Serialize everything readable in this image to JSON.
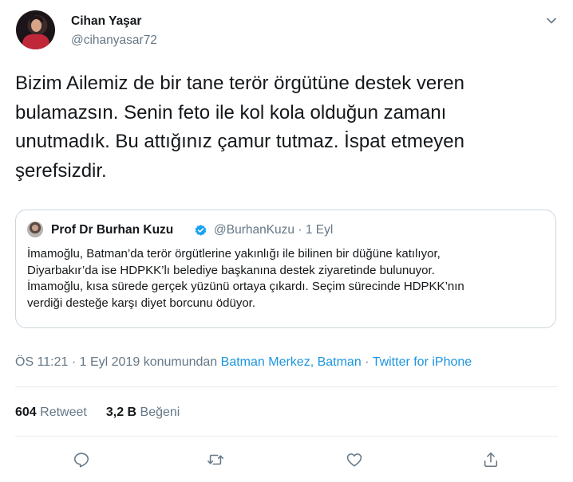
{
  "author": {
    "name": "Cihan Yaşar",
    "handle": "@cihanyasar72"
  },
  "tweet_text": "Bizim Ailemiz de bir tane terör örgütüne destek veren\nbulamazsın. Senin feto ile kol kola olduğun zamanı\nunutmadık. Bu attığınız çamur tutmaz. İspat etmeyen\nşerefsizdir.",
  "quoted": {
    "name": "Prof Dr Burhan Kuzu",
    "handle_date": "@BurhanKuzu · 1 Eyl",
    "text": "İmamoğlu, Batman’da terör örgütlerine yakınlığı ile bilinen bir düğüne katılıyor,\nDiyarbakır’da ise HDPKK’lı belediye başkanına destek ziyaretinde bulunuyor.\nİmamoğlu, kısa sürede gerçek yüzünü ortaya çıkardı. Seçim sürecinde HDPKK’nın\nverdiği desteğe karşı diyet borcunu ödüyor."
  },
  "meta": {
    "time": "ÖS 11:21 · 1 Eyl 2019 konumundan ",
    "location": "Batman Merkez, Batman",
    "sep": " · ",
    "source": "Twitter for iPhone"
  },
  "stats": {
    "retweets": "604",
    "retweets_label": " Retweet",
    "likes": "3,2 B",
    "likes_label": " Beğeni"
  },
  "icons": {
    "caret": "chevron-down-icon",
    "reply": "reply-icon",
    "retweet": "retweet-icon",
    "like": "heart-icon",
    "share": "share-icon",
    "verified": "verified-badge-icon"
  },
  "colors": {
    "link": "#1b95e0",
    "secondary": "#657786",
    "verified": "#1da1f2"
  }
}
